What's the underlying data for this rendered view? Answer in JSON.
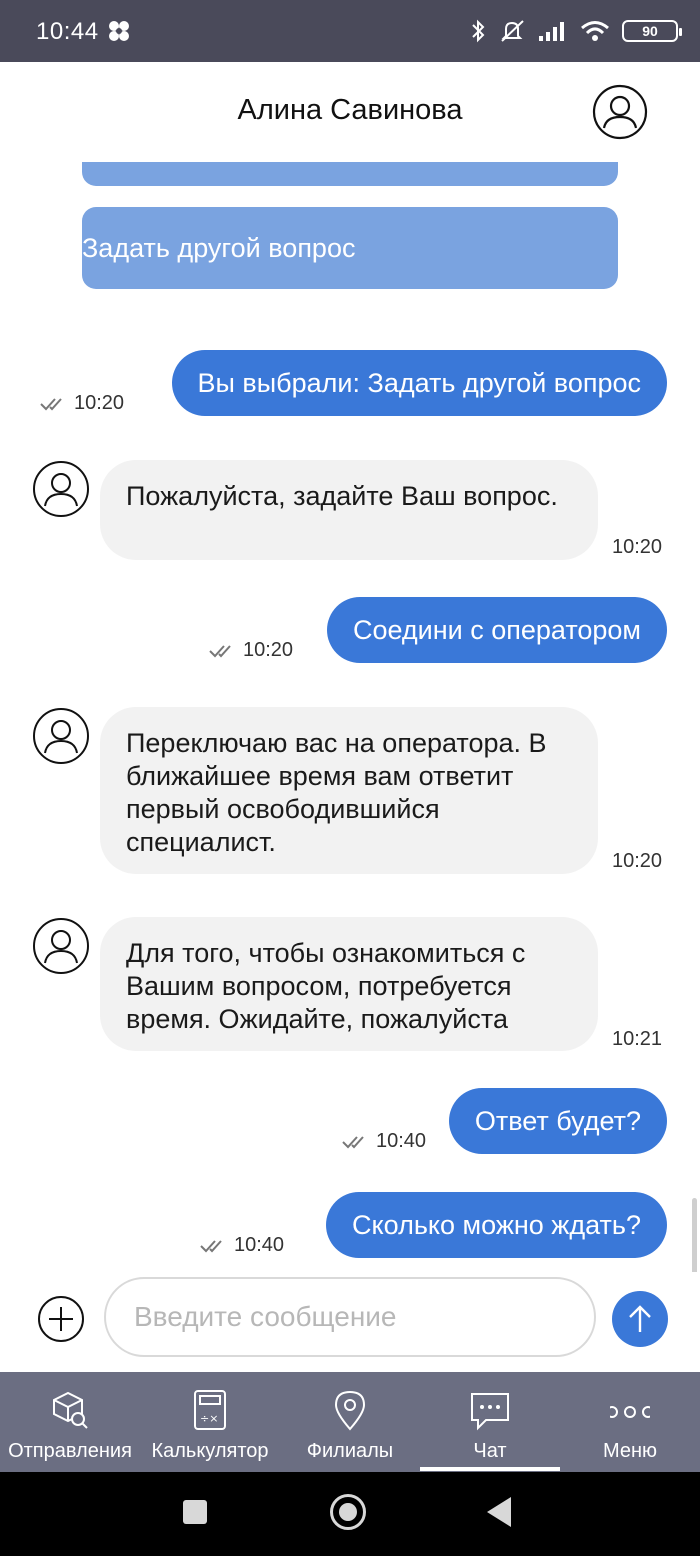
{
  "status_bar": {
    "time": "10:44",
    "battery": "90"
  },
  "header": {
    "title": "Алина Савинова"
  },
  "options": {
    "other_question": "Задать другой вопрос"
  },
  "messages": {
    "m1": {
      "text": "Вы выбрали: Задать другой вопрос",
      "time": "10:20"
    },
    "m2": {
      "text": "Пожалуйста, задайте Ваш вопрос.",
      "time": "10:20"
    },
    "m3": {
      "text": "Соедини с оператором",
      "time": "10:20"
    },
    "m4": {
      "text": "Переключаю вас на оператора. В ближайшее время вам ответит первый освободившийся специалист.",
      "time": "10:20"
    },
    "m5": {
      "text": "Для того, чтобы ознакомиться с Вашим вопросом, потребуется время. Ожидайте, пожалуйста",
      "time": "10:21"
    },
    "m6": {
      "text": "Ответ будет?",
      "time": "10:40"
    },
    "m7": {
      "text": "Сколько можно ждать?",
      "time": "10:40"
    }
  },
  "composer": {
    "placeholder": "Введите сообщение"
  },
  "tabs": [
    {
      "label": "Отправления",
      "icon": "package-search-icon"
    },
    {
      "label": "Калькулятор",
      "icon": "calculator-icon"
    },
    {
      "label": "Филиалы",
      "icon": "location-pin-icon"
    },
    {
      "label": "Чат",
      "icon": "chat-icon"
    },
    {
      "label": "Меню",
      "icon": "more-dots-icon"
    }
  ],
  "active_tab": "Чат",
  "colors": {
    "accent": "#3a78d8",
    "option": "#7aa3e0",
    "tabbar": "#6b6e82",
    "incoming_bubble": "#f2f2f2"
  }
}
